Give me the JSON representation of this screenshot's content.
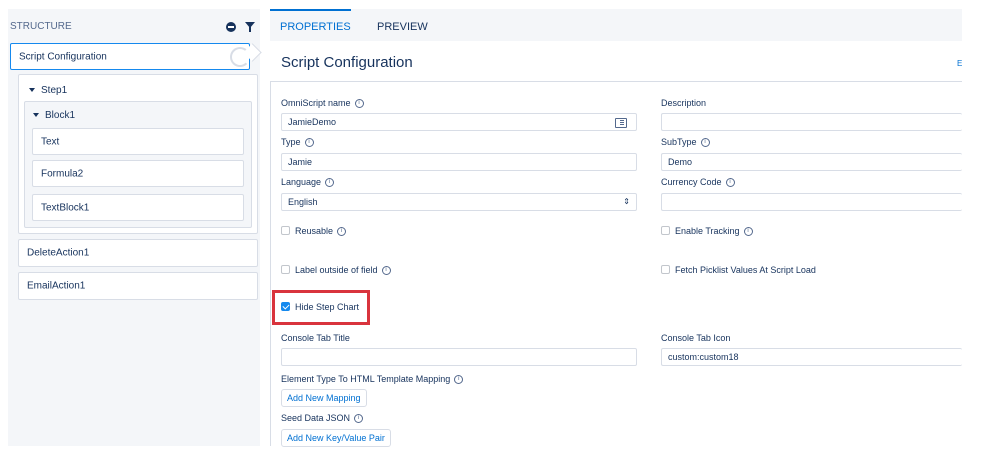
{
  "structure": {
    "title": "STRUCTURE",
    "selected": "Script Configuration",
    "step": "Step1",
    "block": "Block1",
    "block_items": [
      "Text",
      "Formula2",
      "TextBlock1"
    ],
    "actions": [
      "DeleteAction1",
      "EmailAction1"
    ]
  },
  "tabs": {
    "properties": "PROPERTIES",
    "preview": "PREVIEW"
  },
  "properties": {
    "title": "Script Configuration",
    "edge_link": "E",
    "omniscript_name": {
      "label": "OmniScript name",
      "value": "JamieDemo"
    },
    "description": {
      "label": "Description",
      "value": ""
    },
    "type": {
      "label": "Type",
      "value": "Jamie"
    },
    "subtype": {
      "label": "SubType",
      "value": "Demo"
    },
    "language": {
      "label": "Language",
      "value": "English"
    },
    "currency_code": {
      "label": "Currency Code",
      "value": ""
    },
    "reusable": {
      "label": "Reusable",
      "checked": false
    },
    "enable_tracking": {
      "label": "Enable Tracking",
      "checked": false
    },
    "label_outside": {
      "label": "Label outside of field",
      "checked": false
    },
    "fetch_picklist": {
      "label": "Fetch Picklist Values At Script Load",
      "checked": false
    },
    "hide_step_chart": {
      "label": "Hide Step Chart",
      "checked": true
    },
    "console_tab_title": {
      "label": "Console Tab Title",
      "value": ""
    },
    "console_tab_icon": {
      "label": "Console Tab Icon",
      "value": "custom:custom18"
    },
    "element_mapping": {
      "label": "Element Type To HTML Template Mapping",
      "button": "Add New Mapping"
    },
    "seed_data": {
      "label": "Seed Data JSON",
      "button": "Add New Key/Value Pair"
    }
  },
  "colors": {
    "accent": "#0070d2",
    "highlight": "#d9343d",
    "checkbox": "#1589ee"
  }
}
